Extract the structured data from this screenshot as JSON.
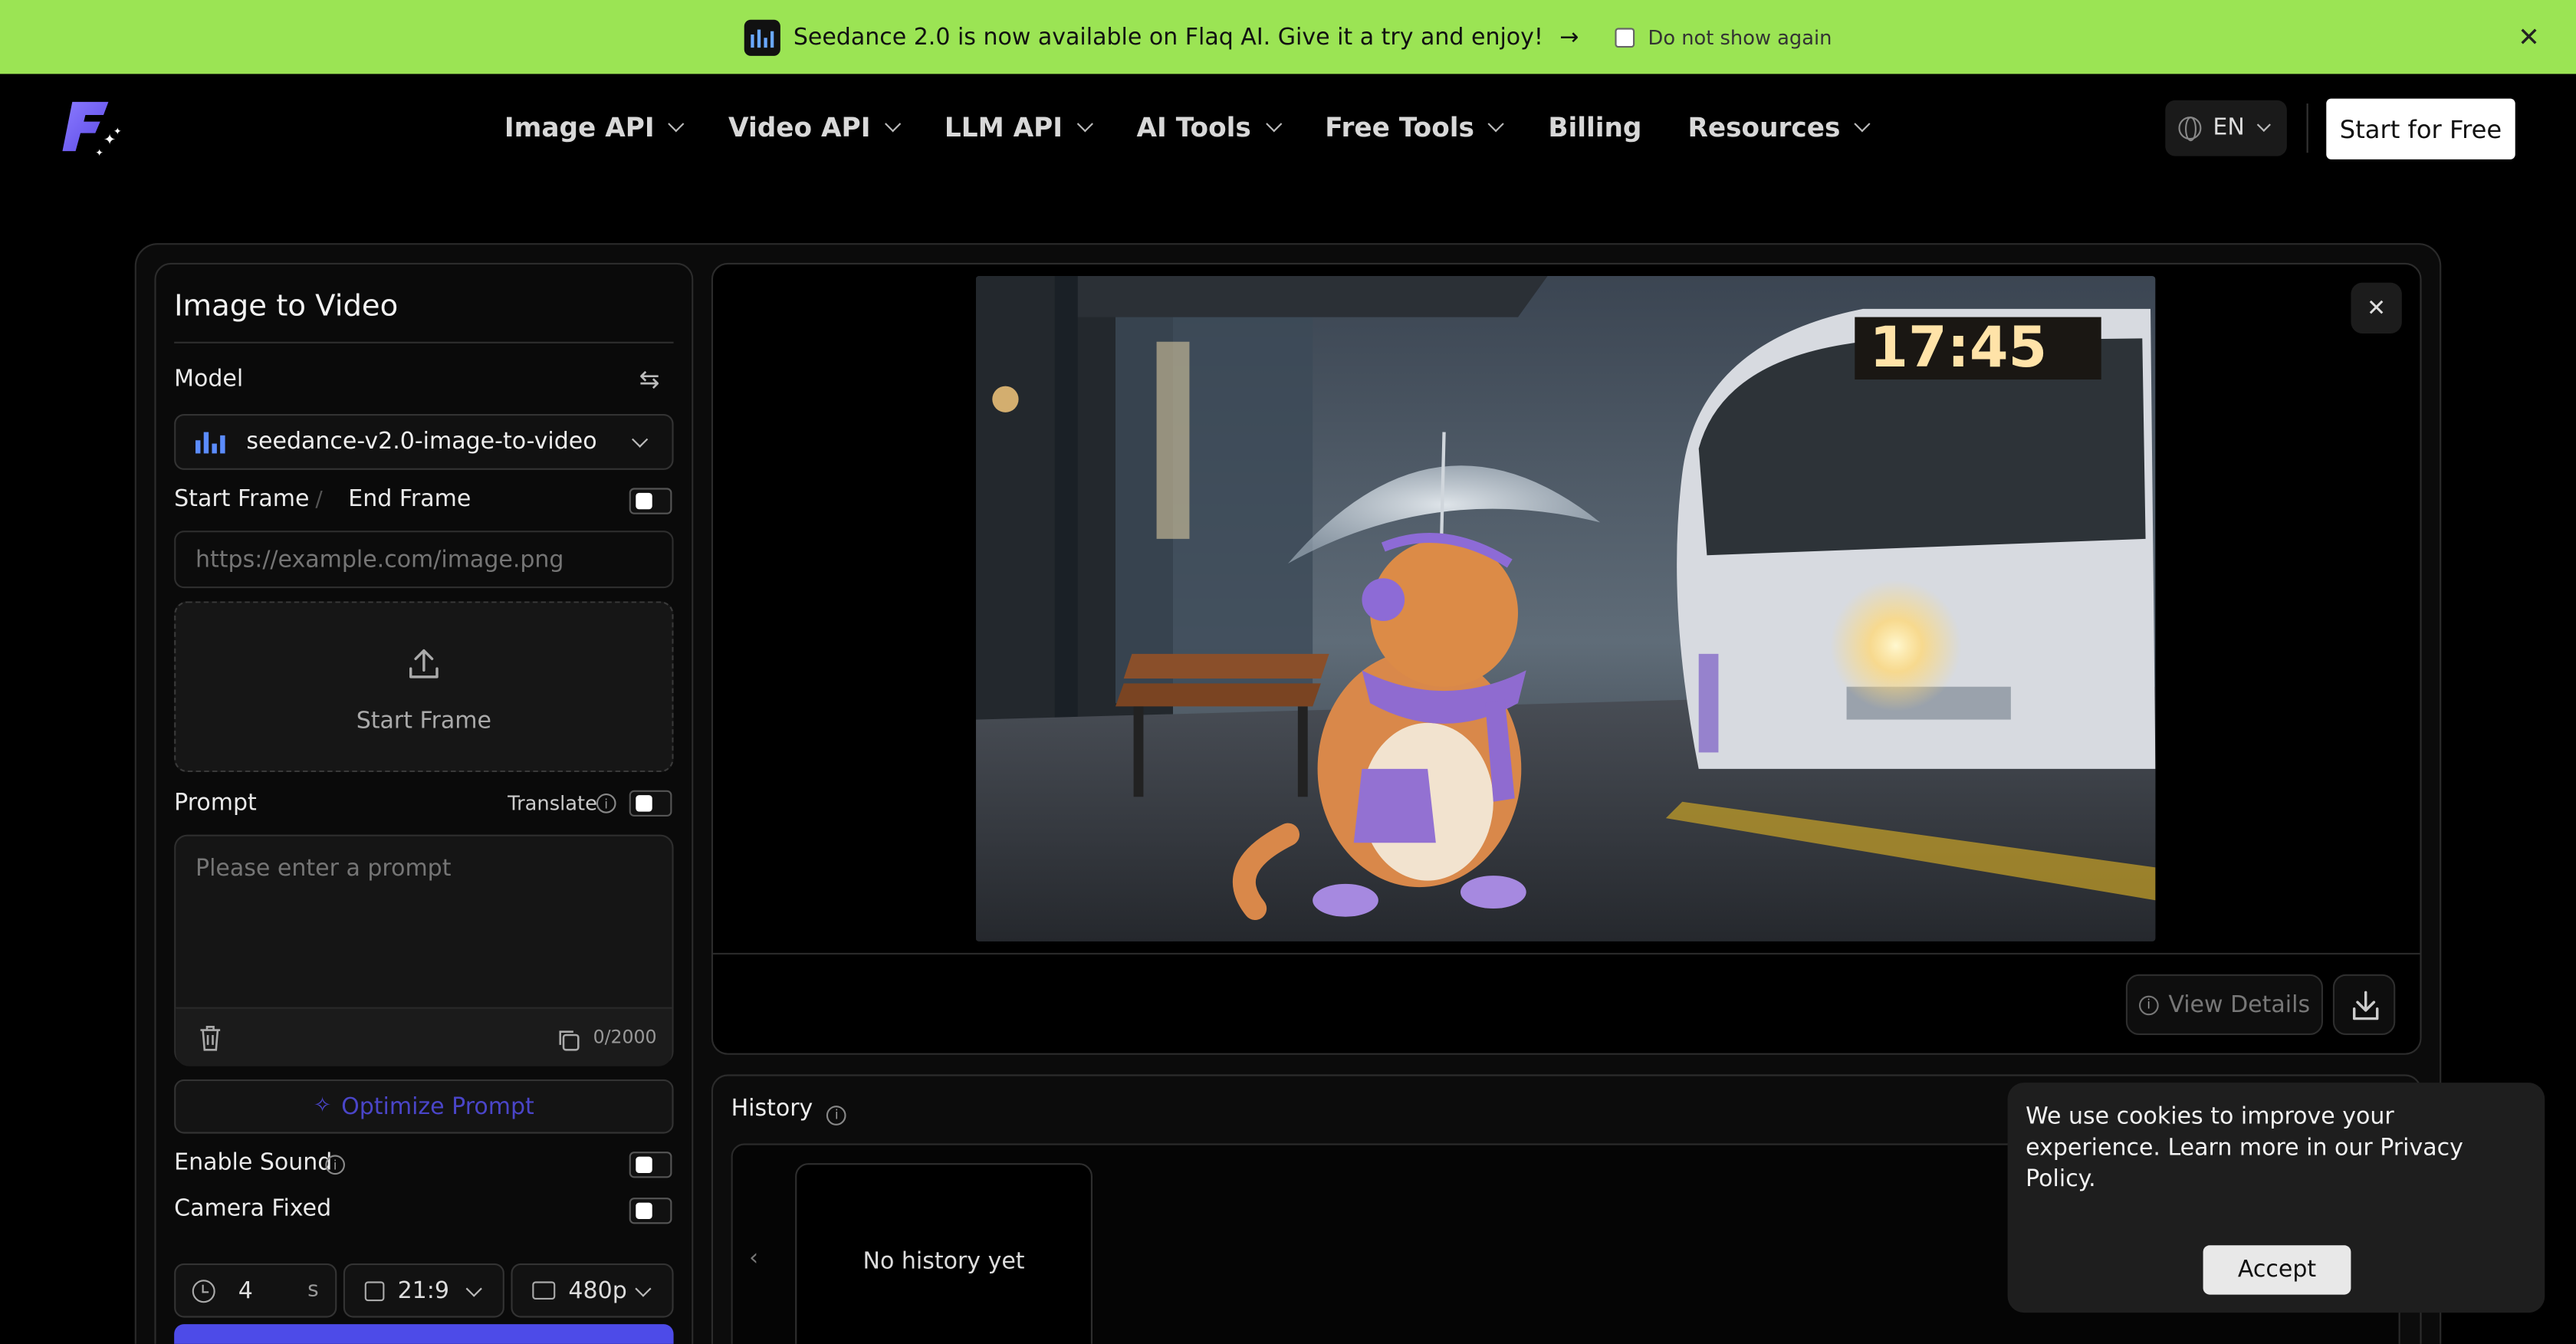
{
  "banner": {
    "text": "Seedance 2.0 is now available on Flaq AI. Give it a try and enjoy!",
    "arrow": "→",
    "checkbox_label": "Do not show again",
    "close": "✕"
  },
  "nav": {
    "menu": [
      "Image API",
      "Video API",
      "LLM API",
      "AI Tools",
      "Free Tools",
      "Billing",
      "Resources"
    ],
    "language": "EN",
    "cta": "Start for Free"
  },
  "panel": {
    "title": "Image to Video",
    "model_label": "Model",
    "swap_icon": "⇆",
    "model_value": "seedance-v2.0-image-to-video",
    "start_frame_label": "Start Frame",
    "divider": "/",
    "end_frame_label": "End Frame",
    "url_placeholder": "https://example.com/image.png",
    "upload_label": "Start Frame",
    "prompt_label": "Prompt",
    "translate_label": "Translate",
    "prompt_placeholder": "Please enter a prompt",
    "char_count": "0/2000",
    "optimize_label": "Optimize Prompt",
    "enable_sound_label": "Enable Sound",
    "camera_fixed_label": "Camera Fixed",
    "duration_value": "4",
    "duration_unit": "s",
    "aspect_value": "21:9",
    "resolution_value": "480p"
  },
  "preview": {
    "close": "✕",
    "clock_text": "17:45",
    "view_details": "View Details"
  },
  "history": {
    "title": "History",
    "empty": "No history yet",
    "prev": "‹"
  },
  "cookie": {
    "text": "We use cookies to improve your experience. Learn more in our Privacy Policy.",
    "accept": "Accept"
  },
  "colors": {
    "banner_bg": "#9be454",
    "accent": "#4d4be8",
    "background": "#000000"
  }
}
